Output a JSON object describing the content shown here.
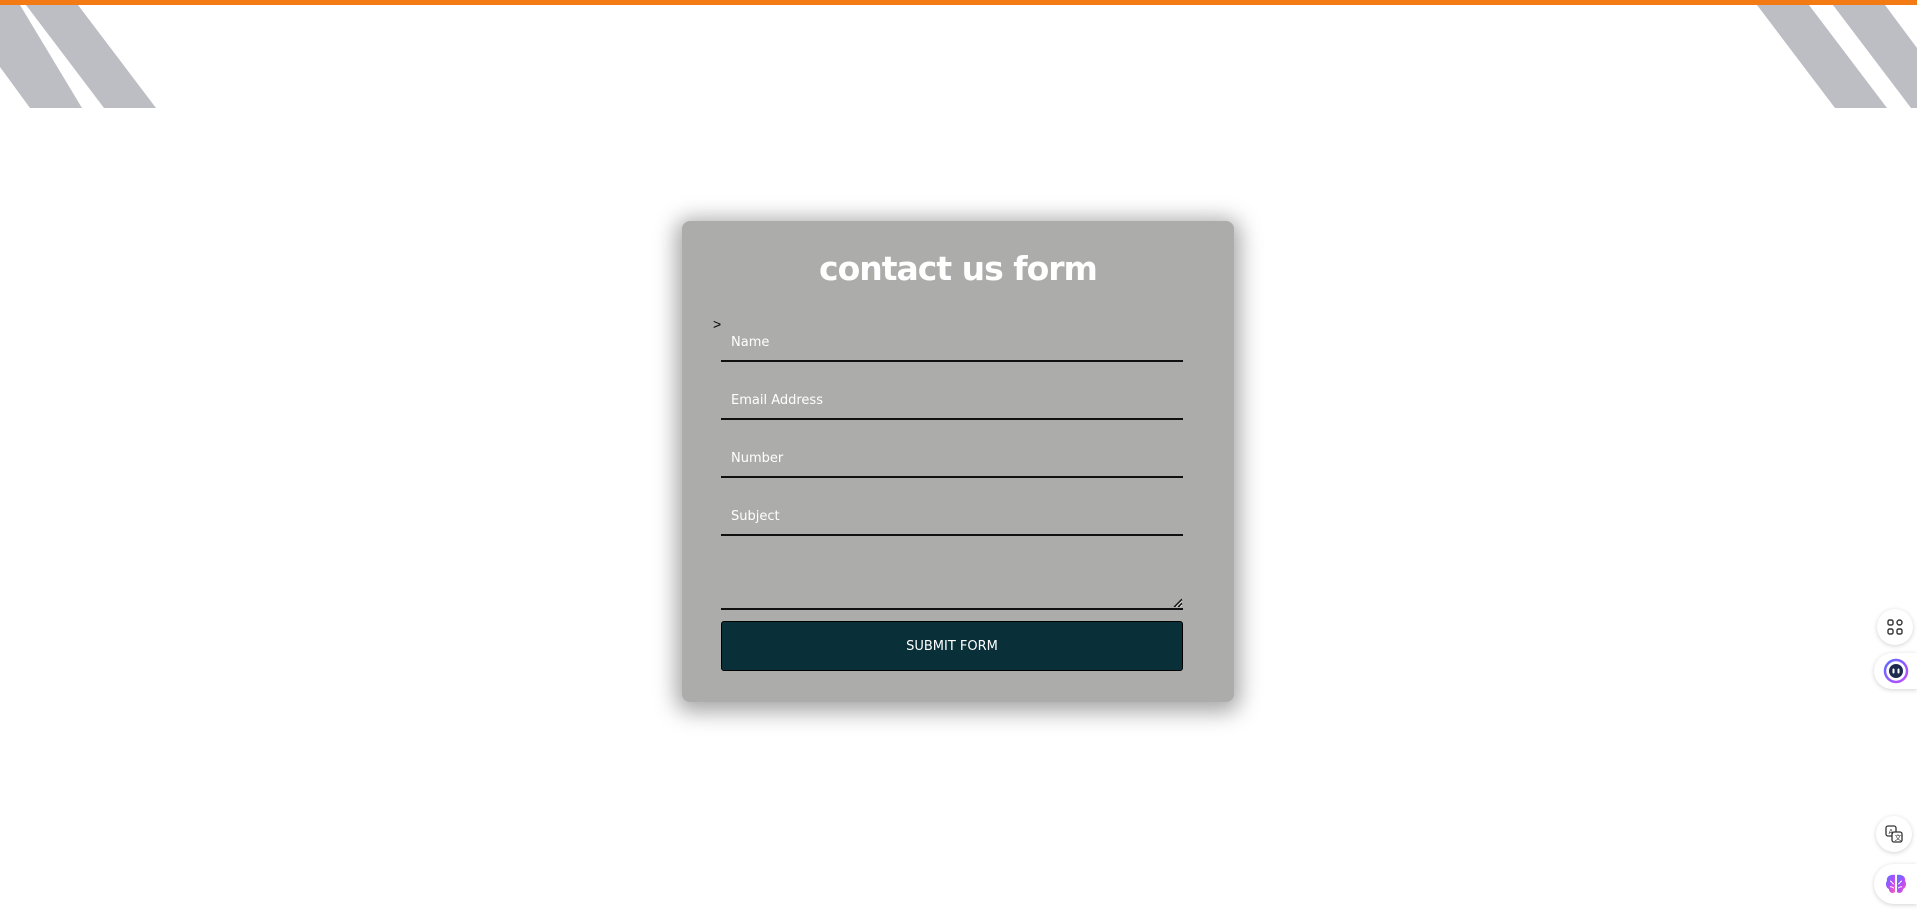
{
  "colors": {
    "top_bar": "#f47b13",
    "stripes": "#bdbec3",
    "card_background": "#acacab",
    "button_background": "#092f39",
    "text_light": "#ffffff"
  },
  "form": {
    "title": "contact us form",
    "stray_text": ">",
    "fields": {
      "name_placeholder": "Name",
      "email_placeholder": "Email Address",
      "number_placeholder": "Number",
      "subject_placeholder": "Subject"
    },
    "submit_label": "SUBMIT FORM"
  },
  "side_widgets": {
    "icons": [
      "apps-grid-icon",
      "assistant-bot-icon",
      "translate-icon",
      "brain-icon"
    ]
  }
}
